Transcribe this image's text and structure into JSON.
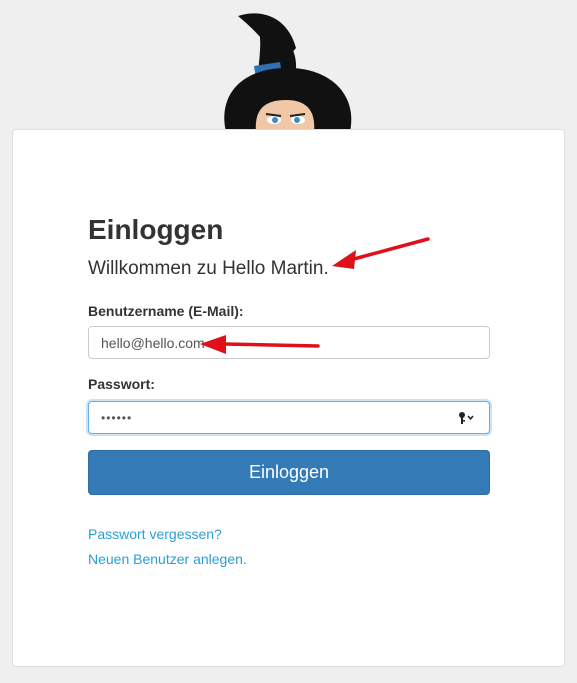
{
  "login": {
    "title": "Einloggen",
    "welcome": "Willkommen zu Hello Martin.",
    "username_label": "Benutzername (E-Mail):",
    "username_value": "hello@hello.com",
    "password_label": "Passwort:",
    "password_value": "••••••",
    "submit_label": "Einloggen",
    "forgot_link": "Passwort vergessen?",
    "register_link": "Neuen Benutzer anlegen."
  },
  "colors": {
    "primary": "#337ab7",
    "link": "#2a9fd6",
    "annotation_arrow": "#e0101a"
  },
  "icons": {
    "mascot": "witch-mascot-icon",
    "password_key": "key-icon",
    "annotation": "red-arrow-icon"
  }
}
